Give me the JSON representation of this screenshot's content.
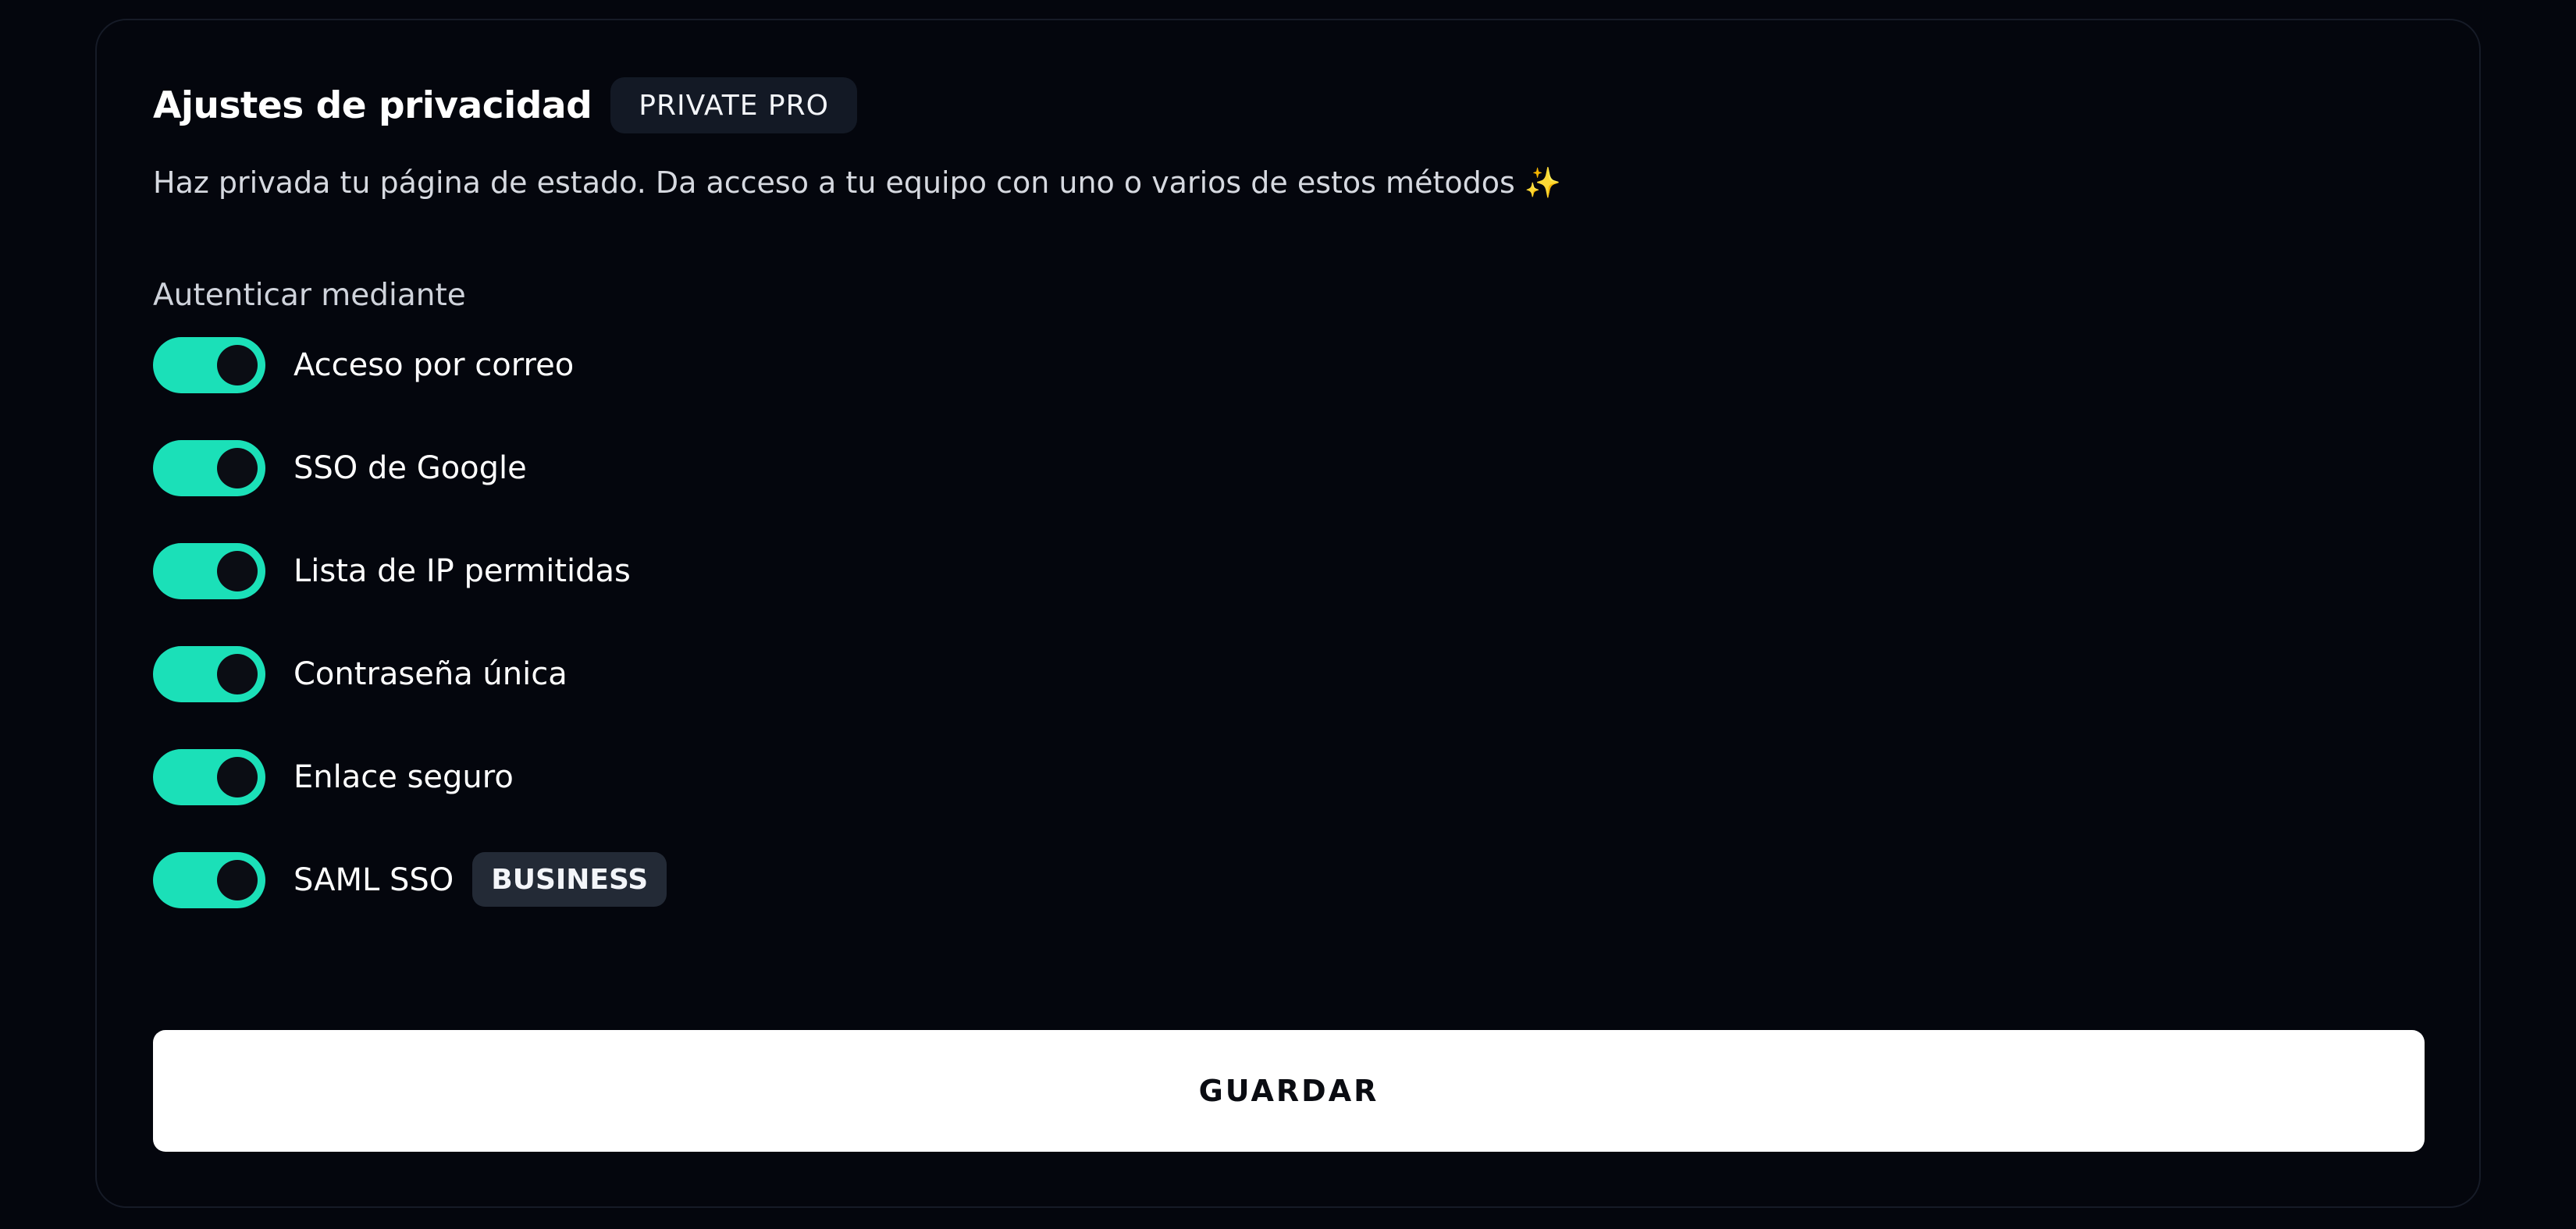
{
  "privacy": {
    "title": "Ajustes de privacidad",
    "plan_badge": "PRIVATE PRO",
    "subtitle": "Haz privada tu página de estado. Da acceso a tu equipo con uno o varios de estos métodos ✨",
    "section_label": "Autenticar mediante",
    "options": [
      {
        "label": "Acceso por correo",
        "enabled": true
      },
      {
        "label": "SSO de Google",
        "enabled": true
      },
      {
        "label": "Lista de IP permitidas",
        "enabled": true
      },
      {
        "label": "Contraseña única",
        "enabled": true
      },
      {
        "label": "Enlace seguro",
        "enabled": true
      },
      {
        "label": "SAML SSO",
        "enabled": true,
        "badge": "BUSINESS"
      }
    ],
    "save_label": "GUARDAR"
  },
  "colors": {
    "background": "#04060d",
    "toggle_on": "#1be0b8",
    "card_border": "#161b27",
    "badge_bg": "#131925",
    "business_badge_bg": "#232a36",
    "button_bg": "#ffffff"
  }
}
